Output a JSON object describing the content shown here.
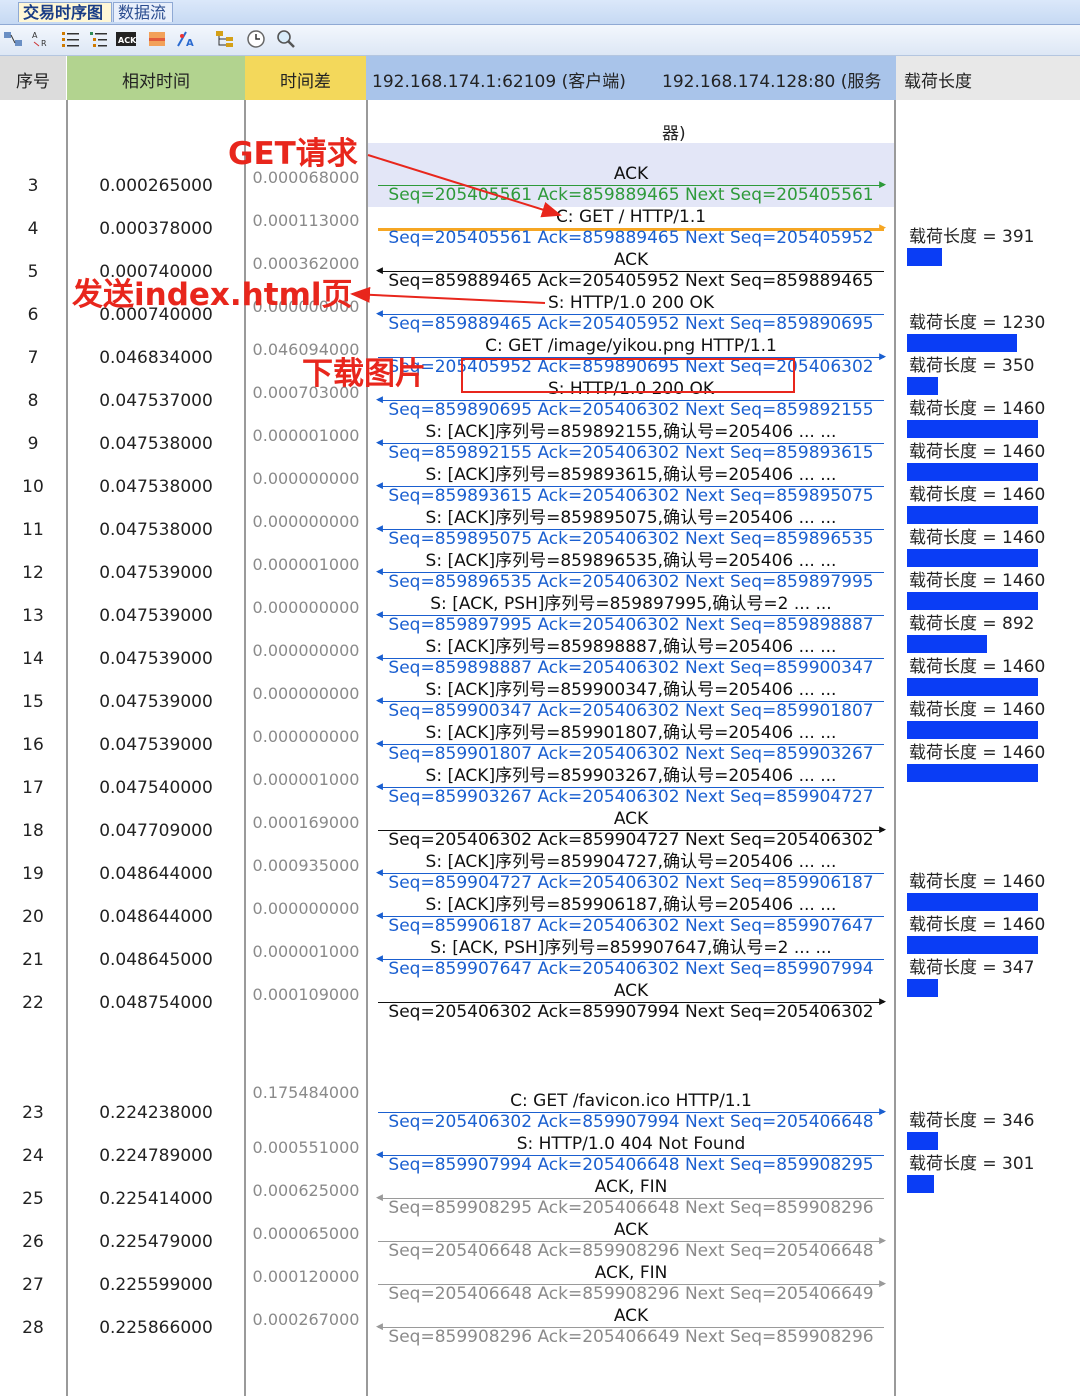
{
  "tabs": [
    {
      "label": "交易时序图",
      "active": true
    },
    {
      "label": "数据流",
      "active": false
    }
  ],
  "toolbar": [
    "flow-icon",
    "decode-icon",
    "list-icon",
    "list-detail-icon",
    "ack-icon",
    "packet-icon",
    "color-icon",
    "tree-icon",
    "clock-icon",
    "search-icon"
  ],
  "columns": {
    "seq": "序号",
    "reltime": "相对时间",
    "delta": "时间差",
    "client": "192.168.174.1:62109 (客户端)",
    "server": "192.168.174.128:80 (服务器)",
    "payload": "载荷长度"
  },
  "colors": {
    "seq_header": "#dcdcdc",
    "reltime_header": "#b2d38f",
    "delta_header": "#f3d85b",
    "flow_header": "#a9c4ea",
    "payload_header": "#e8e8e8",
    "payload_bar": "#0a3df5",
    "annotation": "#e8261c",
    "highlight": "#e3e6f7",
    "orange_arrow": "#f6a623"
  },
  "annotations": {
    "get_request": "GET请求",
    "send_index": "发送index.html页",
    "download_image": "下载图片"
  },
  "rows": [
    {
      "no": "3",
      "rel": "0.000265000",
      "delta": "0.000068000",
      "top": "ACK",
      "bot": "Seq=205405561  Ack=859889465  Next Seq=205405561",
      "dir": "right",
      "color": "green",
      "payload": "",
      "payload_len": 0
    },
    {
      "no": "4",
      "rel": "0.000378000",
      "delta": "0.000113000",
      "top": "C: GET / HTTP/1.1",
      "bot": "Seq=205405561  Ack=859889465  Next Seq=205405952",
      "dir": "right",
      "color": "blue",
      "payload": "载荷长度 = 391",
      "payload_len": 391
    },
    {
      "no": "5",
      "rel": "0.000740000",
      "delta": "0.000362000",
      "top": "ACK",
      "bot": "Seq=859889465  Ack=205405952  Next Seq=859889465",
      "dir": "left",
      "color": "black",
      "payload": "",
      "payload_len": 0
    },
    {
      "no": "6",
      "rel": "0.000740000",
      "delta": "0.000000000",
      "top": "S: HTTP/1.0 200 OK",
      "bot": "Seq=859889465  Ack=205405952  Next Seq=859890695",
      "dir": "left",
      "color": "blue",
      "payload": "载荷长度 = 1230",
      "payload_len": 1230
    },
    {
      "no": "7",
      "rel": "0.046834000",
      "delta": "0.046094000",
      "top": "C: GET /image/yikou.png HTTP/1.1",
      "bot": "Seq=205405952  Ack=859890695  Next Seq=205406302",
      "dir": "right",
      "color": "blue",
      "payload": "载荷长度 = 350",
      "payload_len": 350
    },
    {
      "no": "8",
      "rel": "0.047537000",
      "delta": "0.000703000",
      "top": "S: HTTP/1.0 200 OK",
      "bot": "Seq=859890695  Ack=205406302  Next Seq=859892155",
      "dir": "left",
      "color": "blue",
      "payload": "载荷长度 = 1460",
      "payload_len": 1460
    },
    {
      "no": "9",
      "rel": "0.047538000",
      "delta": "0.000001000",
      "top": "S: [ACK]序列号=859892155,确认号=205406  ...  ...",
      "bot": "Seq=859892155  Ack=205406302  Next Seq=859893615",
      "dir": "left",
      "color": "blue",
      "payload": "载荷长度 = 1460",
      "payload_len": 1460
    },
    {
      "no": "10",
      "rel": "0.047538000",
      "delta": "0.000000000",
      "top": "S: [ACK]序列号=859893615,确认号=205406  ...  ...",
      "bot": "Seq=859893615  Ack=205406302  Next Seq=859895075",
      "dir": "left",
      "color": "blue",
      "payload": "载荷长度 = 1460",
      "payload_len": 1460
    },
    {
      "no": "11",
      "rel": "0.047538000",
      "delta": "0.000000000",
      "top": "S: [ACK]序列号=859895075,确认号=205406  ...  ...",
      "bot": "Seq=859895075  Ack=205406302  Next Seq=859896535",
      "dir": "left",
      "color": "blue",
      "payload": "载荷长度 = 1460",
      "payload_len": 1460
    },
    {
      "no": "12",
      "rel": "0.047539000",
      "delta": "0.000001000",
      "top": "S: [ACK]序列号=859896535,确认号=205406  ...  ...",
      "bot": "Seq=859896535  Ack=205406302  Next Seq=859897995",
      "dir": "left",
      "color": "blue",
      "payload": "载荷长度 = 1460",
      "payload_len": 1460
    },
    {
      "no": "13",
      "rel": "0.047539000",
      "delta": "0.000000000",
      "top": "S: [ACK, PSH]序列号=859897995,确认号=2  ...  ...",
      "bot": "Seq=859897995  Ack=205406302  Next Seq=859898887",
      "dir": "left",
      "color": "blue",
      "payload": "载荷长度 = 892",
      "payload_len": 892
    },
    {
      "no": "14",
      "rel": "0.047539000",
      "delta": "0.000000000",
      "top": "S: [ACK]序列号=859898887,确认号=205406  ...  ...",
      "bot": "Seq=859898887  Ack=205406302  Next Seq=859900347",
      "dir": "left",
      "color": "blue",
      "payload": "载荷长度 = 1460",
      "payload_len": 1460
    },
    {
      "no": "15",
      "rel": "0.047539000",
      "delta": "0.000000000",
      "top": "S: [ACK]序列号=859900347,确认号=205406  ...  ...",
      "bot": "Seq=859900347  Ack=205406302  Next Seq=859901807",
      "dir": "left",
      "color": "blue",
      "payload": "载荷长度 = 1460",
      "payload_len": 1460
    },
    {
      "no": "16",
      "rel": "0.047539000",
      "delta": "0.000000000",
      "top": "S: [ACK]序列号=859901807,确认号=205406  ...  ...",
      "bot": "Seq=859901807  Ack=205406302  Next Seq=859903267",
      "dir": "left",
      "color": "blue",
      "payload": "载荷长度 = 1460",
      "payload_len": 1460
    },
    {
      "no": "17",
      "rel": "0.047540000",
      "delta": "0.000001000",
      "top": "S: [ACK]序列号=859903267,确认号=205406  ...  ...",
      "bot": "Seq=859903267  Ack=205406302  Next Seq=859904727",
      "dir": "left",
      "color": "blue",
      "payload": "",
      "payload_len": 0
    },
    {
      "no": "18",
      "rel": "0.047709000",
      "delta": "0.000169000",
      "top": "ACK",
      "bot": "Seq=205406302  Ack=859904727  Next Seq=205406302",
      "dir": "right",
      "color": "black",
      "payload": "",
      "payload_len": 0
    },
    {
      "no": "19",
      "rel": "0.048644000",
      "delta": "0.000935000",
      "top": "S: [ACK]序列号=859904727,确认号=205406  ...  ...",
      "bot": "Seq=859904727  Ack=205406302  Next Seq=859906187",
      "dir": "left",
      "color": "blue",
      "payload": "载荷长度 = 1460",
      "payload_len": 1460
    },
    {
      "no": "20",
      "rel": "0.048644000",
      "delta": "0.000000000",
      "top": "S: [ACK]序列号=859906187,确认号=205406  ...  ...",
      "bot": "Seq=859906187  Ack=205406302  Next Seq=859907647",
      "dir": "left",
      "color": "blue",
      "payload": "载荷长度 = 1460",
      "payload_len": 1460
    },
    {
      "no": "21",
      "rel": "0.048645000",
      "delta": "0.000001000",
      "top": "S: [ACK, PSH]序列号=859907647,确认号=2  ...  ...",
      "bot": "Seq=859907647  Ack=205406302  Next Seq=859907994",
      "dir": "left",
      "color": "blue",
      "payload": "载荷长度 = 347",
      "payload_len": 347
    },
    {
      "no": "22",
      "rel": "0.048754000",
      "delta": "0.000109000",
      "top": "ACK",
      "bot": "Seq=205406302  Ack=859907994  Next Seq=205406302",
      "dir": "right",
      "color": "black",
      "payload": "",
      "payload_len": 0
    },
    {
      "no": "23",
      "rel": "0.224238000",
      "delta": "0.175484000",
      "top": "C: GET /favicon.ico HTTP/1.1",
      "bot": "Seq=205406302  Ack=859907994  Next Seq=205406648",
      "dir": "right",
      "color": "blue",
      "payload": "载荷长度 = 346",
      "payload_len": 346
    },
    {
      "no": "24",
      "rel": "0.224789000",
      "delta": "0.000551000",
      "top": "S: HTTP/1.0 404 Not Found",
      "bot": "Seq=859907994  Ack=205406648  Next Seq=859908295",
      "dir": "left",
      "color": "blue",
      "payload": "载荷长度 = 301",
      "payload_len": 301
    },
    {
      "no": "25",
      "rel": "0.225414000",
      "delta": "0.000625000",
      "top": "ACK, FIN",
      "bot": "Seq=859908295  Ack=205406648  Next Seq=859908296",
      "dir": "left",
      "color": "gray",
      "payload": "",
      "payload_len": 0
    },
    {
      "no": "26",
      "rel": "0.225479000",
      "delta": "0.000065000",
      "top": "ACK",
      "bot": "Seq=205406648  Ack=859908296  Next Seq=205406648",
      "dir": "right",
      "color": "gray",
      "payload": "",
      "payload_len": 0
    },
    {
      "no": "27",
      "rel": "0.225599000",
      "delta": "0.000120000",
      "top": "ACK, FIN",
      "bot": "Seq=205406648  Ack=859908296  Next Seq=205406649",
      "dir": "right",
      "color": "gray",
      "payload": "",
      "payload_len": 0
    },
    {
      "no": "28",
      "rel": "0.225866000",
      "delta": "0.000267000",
      "top": "ACK",
      "bot": "Seq=859908296  Ack=205406649  Next Seq=859908296",
      "dir": "left",
      "color": "gray",
      "payload": "",
      "payload_len": 0
    }
  ]
}
